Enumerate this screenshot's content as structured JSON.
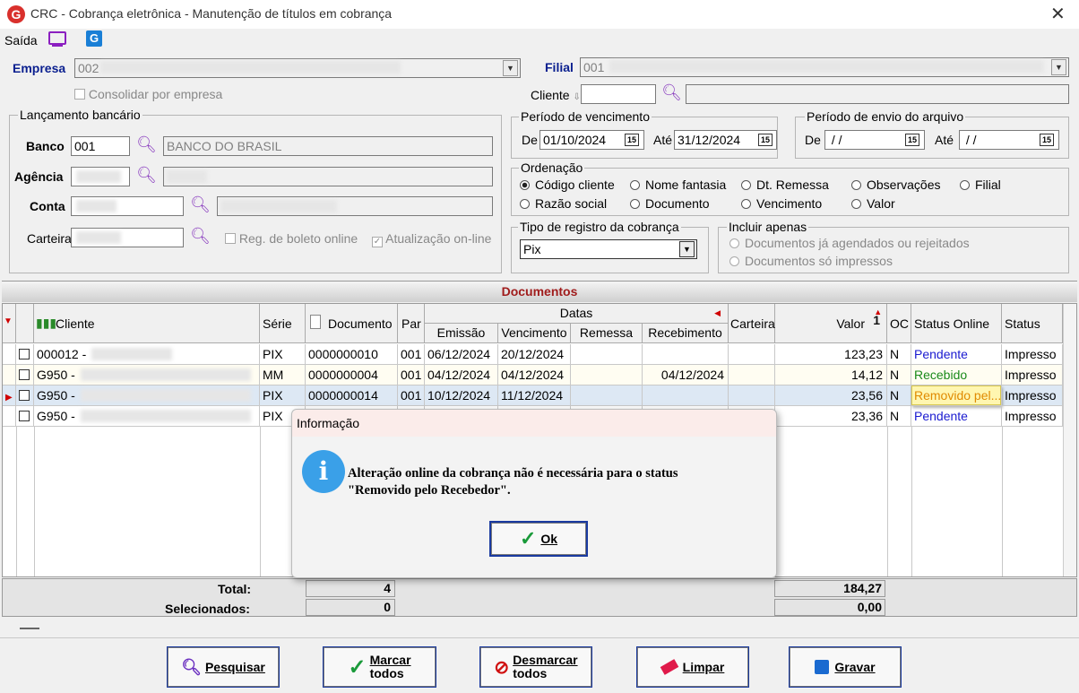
{
  "window": {
    "title": "CRC - Cobrança eletrônica - Manutenção de títulos em cobrança",
    "logo_letter": "G",
    "close_glyph": "✕"
  },
  "toolbar": {
    "saida": "Saída"
  },
  "empresa": {
    "label": "Empresa",
    "code": "002",
    "consolidar": "Consolidar por empresa"
  },
  "filial": {
    "label": "Filial",
    "code": "001"
  },
  "cliente": {
    "label": "Cliente"
  },
  "lancamento": {
    "legend": "Lançamento bancário",
    "banco_label": "Banco",
    "banco_code": "001",
    "banco_name": "BANCO DO BRASIL",
    "agencia_label": "Agência",
    "conta_label": "Conta",
    "carteira_label": "Carteira",
    "reg_boleto": "Reg. de boleto online",
    "atualizacao": "Atualização on-line"
  },
  "vencimento": {
    "legend": "Período de vencimento",
    "de_label": "De",
    "de": "01/10/2024",
    "ate_label": "Até",
    "ate": "31/12/2024"
  },
  "envio": {
    "legend": "Período de envio do arquivo",
    "de_label": "De",
    "de": " / /",
    "ate_label": "Até",
    "ate": " / /"
  },
  "ordenacao": {
    "legend": "Ordenação",
    "opts": [
      "Código cliente",
      "Nome fantasia",
      "Dt. Remessa",
      "Observações",
      "Filial",
      "Razão social",
      "Documento",
      "Vencimento",
      "Valor"
    ]
  },
  "tipo": {
    "legend": "Tipo de registro da cobrança",
    "value": "Pix"
  },
  "incluir": {
    "legend": "Incluir apenas",
    "opt1": "Documentos já agendados ou rejeitados",
    "opt2": "Documentos só impressos"
  },
  "grid": {
    "title": "Documentos",
    "headers": {
      "cliente": "Cliente",
      "serie": "Série",
      "documento": "Documento",
      "par": "Par",
      "datas": "Datas",
      "emissao": "Emissão",
      "vencimento": "Vencimento",
      "remessa": "Remessa",
      "recebimento": "Recebimento",
      "carteira": "Carteira",
      "valor": "Valor",
      "sort_num": "1",
      "oc": "OC",
      "status_online": "Status Online",
      "status": "Status"
    },
    "rows": [
      {
        "cliente": "000012 -",
        "serie": "PIX",
        "documento": "0000000010",
        "par": "001",
        "emissao": "06/12/2024",
        "vencimento": "20/12/2024",
        "remessa": "",
        "recebimento": "",
        "carteira": "",
        "valor": "123,23",
        "oc": "N",
        "status_online": "Pendente",
        "status": "Impresso"
      },
      {
        "cliente": "G950 -",
        "serie": "MM",
        "documento": "0000000004",
        "par": "001",
        "emissao": "04/12/2024",
        "vencimento": "04/12/2024",
        "remessa": "",
        "recebimento": "04/12/2024",
        "carteira": "",
        "valor": "14,12",
        "oc": "N",
        "status_online": "Recebido",
        "status": "Impresso"
      },
      {
        "cliente": "G950 -",
        "serie": "PIX",
        "documento": "0000000014",
        "par": "001",
        "emissao": "10/12/2024",
        "vencimento": "11/12/2024",
        "remessa": "",
        "recebimento": "",
        "carteira": "",
        "valor": "23,56",
        "oc": "N",
        "status_online": "Removido pel...",
        "status": "Impresso"
      },
      {
        "cliente": "G950 -",
        "serie": "PIX",
        "documento": "",
        "par": "",
        "emissao": "",
        "vencimento": "",
        "remessa": "",
        "recebimento": "",
        "carteira": "",
        "valor": "23,36",
        "oc": "N",
        "status_online": "Pendente",
        "status": "Impresso"
      }
    ],
    "total_label": "Total:",
    "total_count": "4",
    "total_value": "184,27",
    "sel_label": "Selecionados:",
    "sel_count": "0",
    "sel_value": "0,00",
    "colors": {
      "pendente": "#1a1ad0",
      "recebido": "#1a8a1a",
      "removido": "#e08a00"
    }
  },
  "dialog": {
    "title": "Informação",
    "message_line1": "Alteração online da cobrança não é necessária para o status",
    "message_line2": "\"Removido pelo Recebedor\".",
    "ok": "Ok",
    "icon": "info-icon"
  },
  "buttons": {
    "pesquisar": "Pesquisar",
    "marcar1": "Marcar",
    "marcar2": "todos",
    "desmarcar1": "Desmarcar",
    "desmarcar2": "todos",
    "limpar": "Limpar",
    "gravar": "Gravar"
  }
}
